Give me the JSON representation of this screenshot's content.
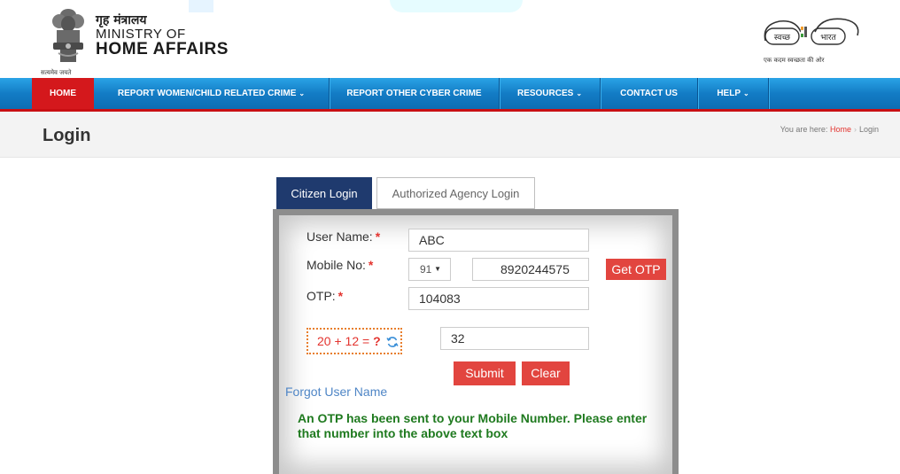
{
  "header": {
    "emblem_motto": "सत्यमेव जयते",
    "ministry_hindi": "गृह मंत्रालय",
    "ministry_line1": "MINISTRY OF",
    "ministry_line2": "HOME AFFAIRS",
    "swachh_left": "स्वच्छ",
    "swachh_right": "भारत",
    "swachh_caption": "एक कदम स्वच्छता की ओर"
  },
  "nav": {
    "items": [
      {
        "label": "HOME",
        "active": true
      },
      {
        "label": "REPORT WOMEN/CHILD RELATED CRIME",
        "dropdown": true
      },
      {
        "label": "REPORT OTHER CYBER CRIME"
      },
      {
        "label": "RESOURCES",
        "dropdown": true
      },
      {
        "label": "CONTACT US"
      },
      {
        "label": "HELP",
        "dropdown": true
      }
    ],
    "chevron": "⌄"
  },
  "page": {
    "title": "Login",
    "breadcrumb": {
      "prefix": "You are here:",
      "home": "Home",
      "separator": "›",
      "current": "Login"
    }
  },
  "tabs": {
    "citizen": "Citizen Login",
    "agency": "Authorized Agency Login"
  },
  "form": {
    "username_label": "User Name:",
    "username_value": "ABC",
    "mobile_label": "Mobile No:",
    "country_code": "91",
    "mobile_value": "8920244575",
    "get_otp_label": "Get OTP",
    "otp_label": "OTP:",
    "otp_value": "104083",
    "required_mark": "*",
    "captcha_expression": "20 + 12 = ",
    "captcha_question": "?",
    "captcha_answer": "32",
    "submit_label": "Submit",
    "clear_label": "Clear",
    "forgot_link": "Forgot User Name",
    "otp_message": "An OTP has been sent to your Mobile Number. Please enter that number into the above text box"
  },
  "colors": {
    "nav_blue": "#137cc5",
    "nav_active_red": "#d4181c",
    "tab_active_navy": "#1f3a6e",
    "button_red": "#e2453f",
    "success_green": "#1f7a1f",
    "link_blue": "#4f86c6"
  }
}
